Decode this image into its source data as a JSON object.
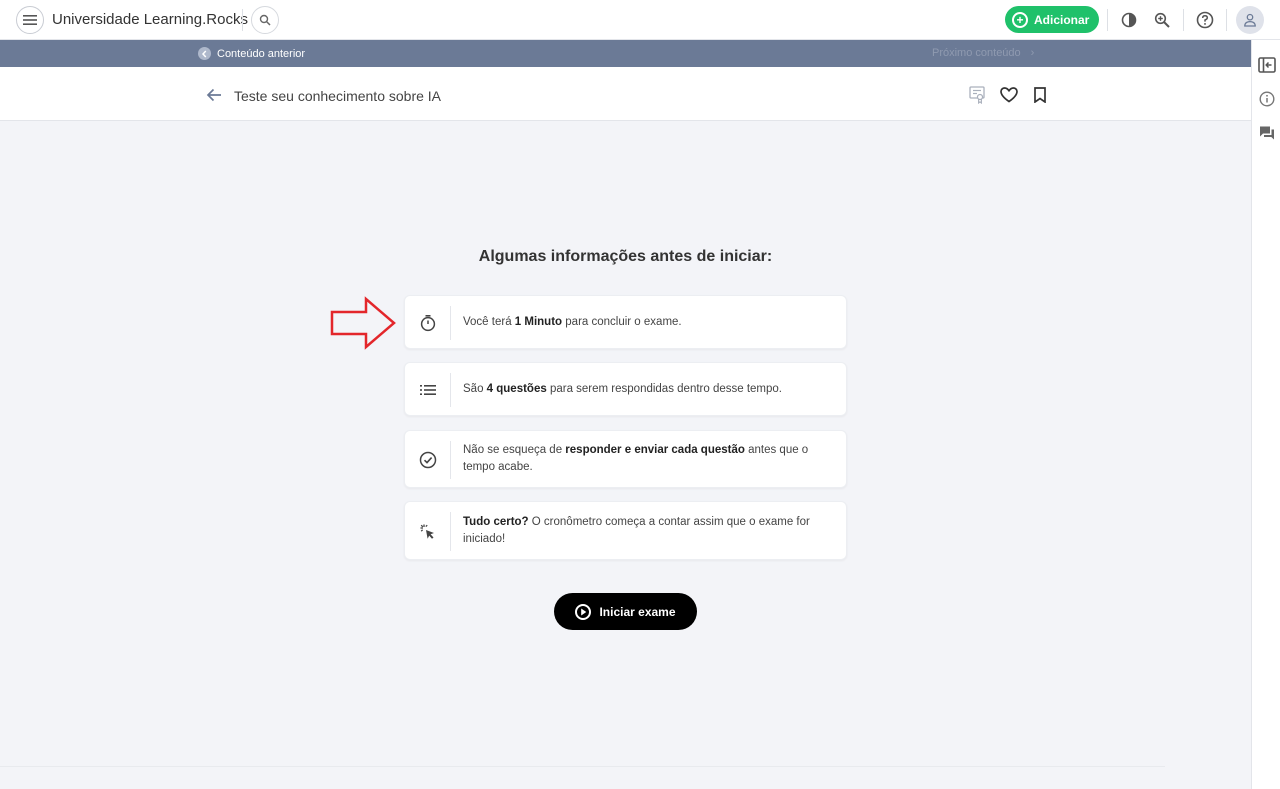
{
  "app": {
    "title": "Universidade Learning.Rocks"
  },
  "topbar": {
    "add_label": "Adicionar",
    "icons": [
      "menu-icon",
      "search-icon",
      "contrast-icon",
      "zoom-in-icon",
      "help-icon",
      "user-icon"
    ],
    "accent_color": "#1fc16a"
  },
  "navbar": {
    "prev_label": "Conteúdo anterior",
    "next_label": "Próximo conteúdo",
    "bg_color": "#6b7a96"
  },
  "header": {
    "title": "Teste seu conhecimento sobre IA",
    "icons": [
      "certificate-icon",
      "heart-icon",
      "bookmark-icon"
    ]
  },
  "main": {
    "title": "Algumas informações antes de iniciar:",
    "cards": [
      {
        "icon": "stopwatch-icon",
        "pre": "Você terá ",
        "bold": "1 Minuto",
        "post": " para concluir o exame."
      },
      {
        "icon": "list-icon",
        "pre": "São ",
        "bold": "4 questões",
        "post": " para serem respondidas dentro desse tempo."
      },
      {
        "icon": "check-circle-icon",
        "pre": "Não se esqueça de ",
        "bold": "responder e enviar cada questão",
        "post": " antes que o tempo acabe."
      },
      {
        "icon": "click-icon",
        "pre": "",
        "bold": "Tudo certo?",
        "post": " O cronômetro começa a contar assim que o exame for iniciado!"
      }
    ],
    "start_label": "Iniciar exame"
  },
  "sidepanel": {
    "icons": [
      "panel-toggle-icon",
      "info-icon",
      "comments-icon"
    ]
  }
}
